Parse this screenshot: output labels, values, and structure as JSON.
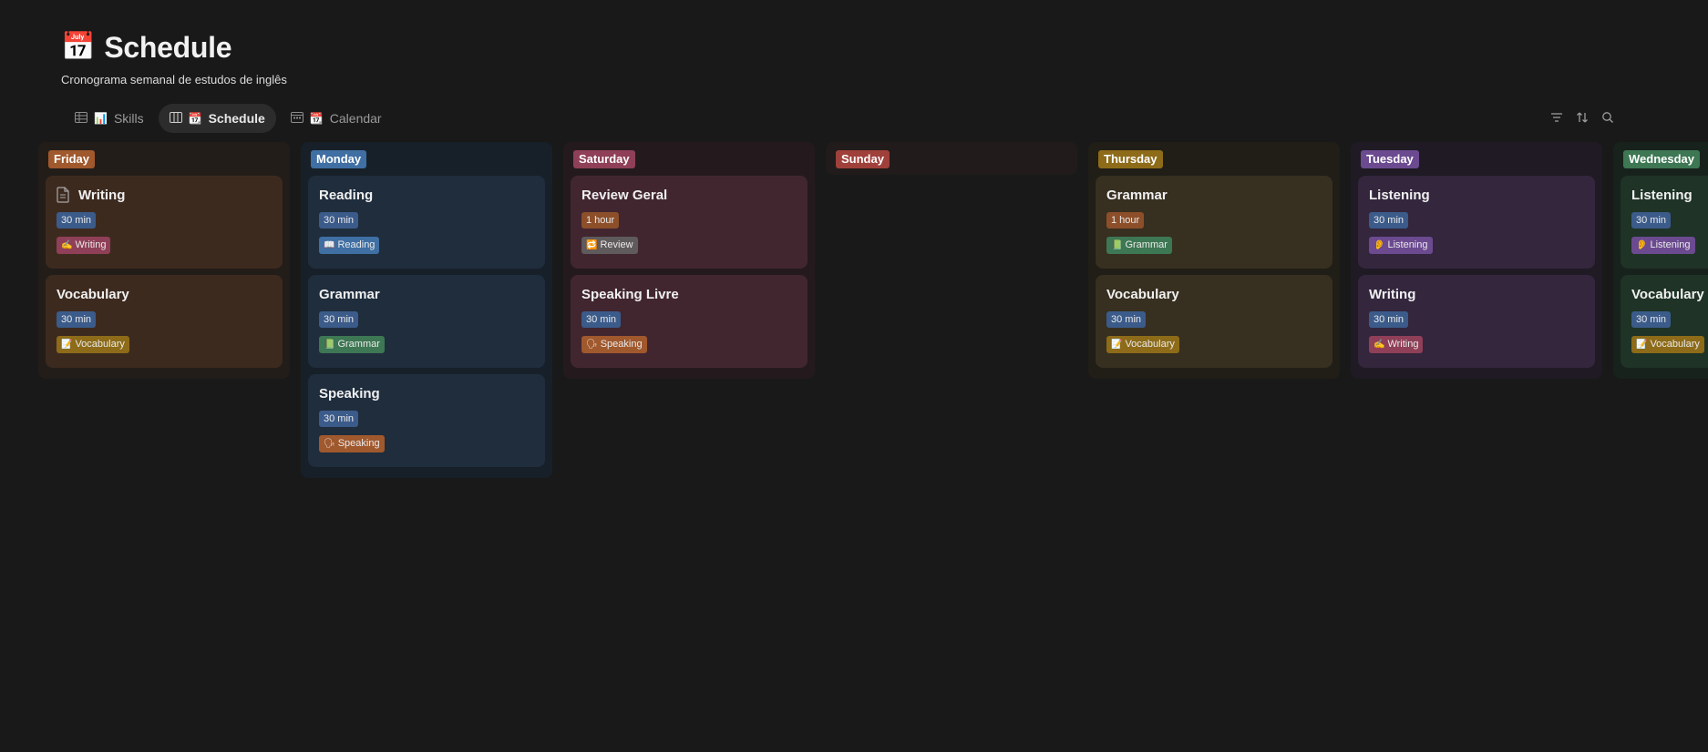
{
  "header": {
    "title_icon": "📅",
    "title": "Schedule",
    "subtitle": "Cronograma semanal de estudos de inglês"
  },
  "tabs": [
    {
      "view_icon": "table-icon",
      "emoji": "📊",
      "label": "Skills",
      "active": false
    },
    {
      "view_icon": "board-icon",
      "emoji": "📆",
      "label": "Schedule",
      "active": true
    },
    {
      "view_icon": "calendar-icon",
      "emoji": "📆",
      "label": "Calendar",
      "active": false
    }
  ],
  "tools": [
    "filter-icon",
    "sort-icon",
    "search-icon"
  ],
  "colors": {
    "background": "#191919",
    "friday": "#a0582d",
    "monday": "#3f6fa3",
    "saturday": "#8f3f57",
    "sunday": "#a0403b",
    "thursday": "#8d6b18",
    "tuesday": "#6b4a90",
    "wednesday": "#3d7753"
  },
  "columns": [
    {
      "day": "Friday",
      "cards": [
        {
          "title": "Writing",
          "has_doc_icon": true,
          "duration": "30 min",
          "tag_emoji": "✍️",
          "tag": "Writing"
        },
        {
          "title": "Vocabulary",
          "has_doc_icon": false,
          "duration": "30 min",
          "tag_emoji": "📝",
          "tag": "Vocabulary"
        }
      ]
    },
    {
      "day": "Monday",
      "cards": [
        {
          "title": "Reading",
          "duration": "30 min",
          "tag_emoji": "📖",
          "tag": "Reading"
        },
        {
          "title": "Grammar",
          "duration": "30 min",
          "tag_emoji": "📗",
          "tag": "Grammar"
        },
        {
          "title": "Speaking",
          "duration": "30 min",
          "tag_emoji": "🗣",
          "tag": "Speaking"
        }
      ]
    },
    {
      "day": "Saturday",
      "cards": [
        {
          "title": "Review Geral",
          "duration": "1 hour",
          "tag_emoji": "🔁",
          "tag": "Review"
        },
        {
          "title": "Speaking Livre",
          "duration": "30 min",
          "tag_emoji": "🗣",
          "tag": "Speaking"
        }
      ]
    },
    {
      "day": "Sunday",
      "cards": []
    },
    {
      "day": "Thursday",
      "cards": [
        {
          "title": "Grammar",
          "duration": "1 hour",
          "tag_emoji": "📗",
          "tag": "Grammar"
        },
        {
          "title": "Vocabulary",
          "duration": "30 min",
          "tag_emoji": "📝",
          "tag": "Vocabulary"
        }
      ]
    },
    {
      "day": "Tuesday",
      "cards": [
        {
          "title": "Listening",
          "duration": "30 min",
          "tag_emoji": "👂",
          "tag": "Listening"
        },
        {
          "title": "Writing",
          "duration": "30 min",
          "tag_emoji": "✍️",
          "tag": "Writing"
        }
      ]
    },
    {
      "day": "Wednesday",
      "cards": [
        {
          "title": "Listening",
          "duration": "30 min",
          "tag_emoji": "👂",
          "tag": "Listening"
        },
        {
          "title": "Vocabulary",
          "duration": "30 min",
          "tag_emoji": "📝",
          "tag": "Vocabulary"
        }
      ]
    }
  ]
}
